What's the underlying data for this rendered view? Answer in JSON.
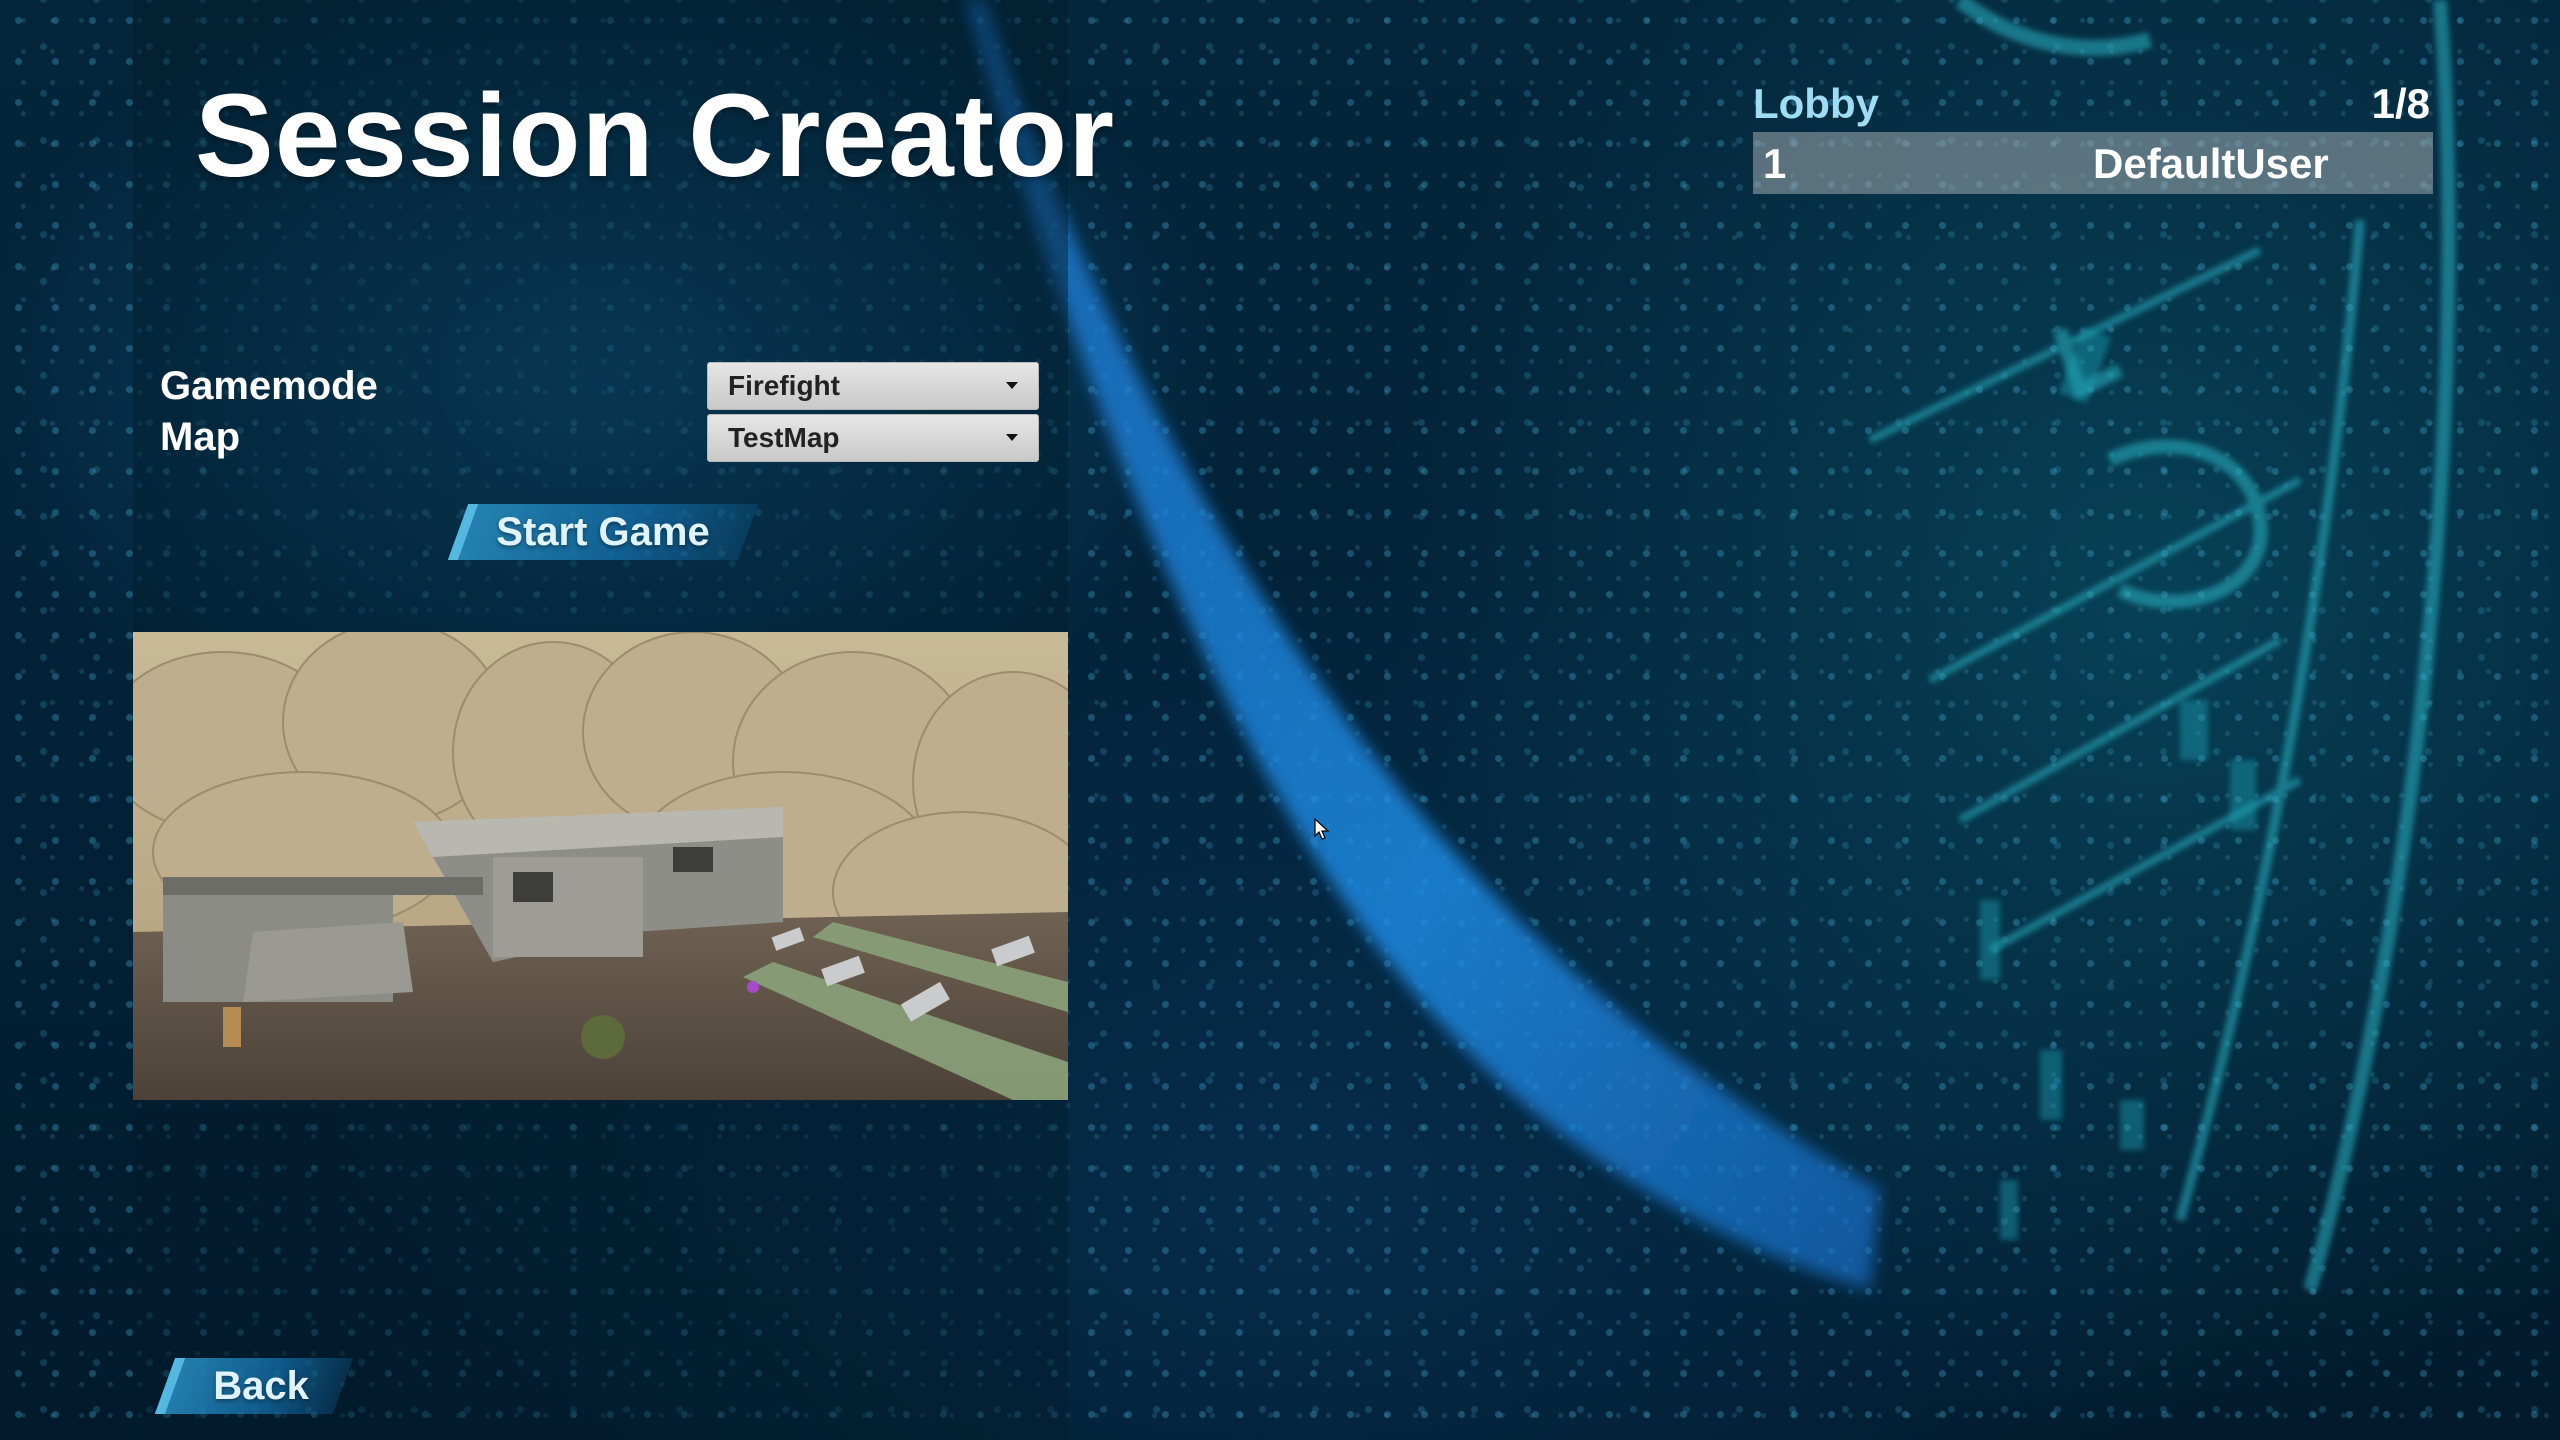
{
  "title": "Session Creator",
  "settings": {
    "gamemode_label": "Gamemode",
    "gamemode_value": "Firefight",
    "map_label": "Map",
    "map_value": "TestMap"
  },
  "buttons": {
    "start_game": "Start Game",
    "back": "Back"
  },
  "lobby": {
    "title": "Lobby",
    "count": "1/8",
    "players": [
      {
        "index": "1",
        "name": "DefaultUser"
      }
    ]
  },
  "icons": {
    "dropdown": "chevron-down-icon",
    "cursor": "mouse-cursor-icon"
  },
  "colors": {
    "accent": "#2a8cc0",
    "lobby_title": "#9fdcf5",
    "dropdown_bg": "#d9d9d9"
  }
}
